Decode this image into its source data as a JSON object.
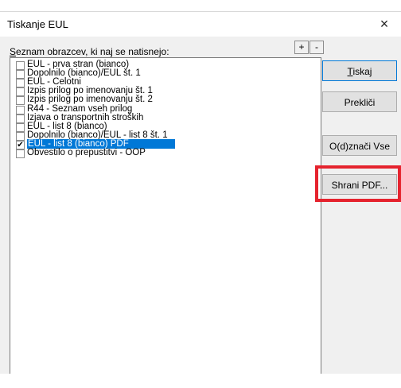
{
  "window": {
    "title": "Tiskanje EUL",
    "close_glyph": "×"
  },
  "list": {
    "label_prefix": "S",
    "label_rest": "eznam obrazcev, ki naj se natisnejo:",
    "plus": "+",
    "minus": "-",
    "items": [
      {
        "label": "EUL - prva stran (bianco)",
        "checked": false,
        "selected": false
      },
      {
        "label": "Dopolnilo (bianco)/EUL št. 1",
        "checked": false,
        "selected": false
      },
      {
        "label": "EUL - Celotni",
        "checked": false,
        "selected": false
      },
      {
        "label": "Izpis prilog po imenovanju št. 1",
        "checked": false,
        "selected": false
      },
      {
        "label": "Izpis prilog po imenovanju št. 2",
        "checked": false,
        "selected": false
      },
      {
        "label": "R44 - Seznam vseh prilog",
        "checked": false,
        "selected": false
      },
      {
        "label": "Izjava o transportnih stroških",
        "checked": false,
        "selected": false
      },
      {
        "label": "EUL - list 8 (bianco)",
        "checked": false,
        "selected": false
      },
      {
        "label": "Dopolnilo (bianco)/EUL - list 8 št. 1",
        "checked": false,
        "selected": false
      },
      {
        "label": "EUL - list 8 (bianco) PDF",
        "checked": true,
        "selected": true
      },
      {
        "label": "Obvestilo o prepustitvi - OOP",
        "checked": false,
        "selected": false
      }
    ]
  },
  "buttons": {
    "print_prefix": "T",
    "print_rest": "iskaj",
    "cancel": "Prekliči",
    "toggle_all": "O(d)znači Vse",
    "save_pdf": "Shrani PDF..."
  },
  "colors": {
    "selection": "#0078d7",
    "highlight": "#e5232e"
  }
}
